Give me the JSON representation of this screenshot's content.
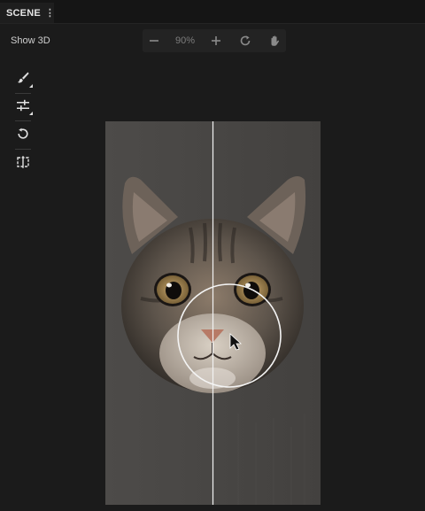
{
  "scene_tab": {
    "label": "SCENE",
    "menu_glyph": "⋮"
  },
  "view": {
    "toggle_label": "Show 3D"
  },
  "zoom": {
    "value": "90%",
    "minus_icon": "minus-icon",
    "plus_icon": "plus-icon",
    "reset_icon": "rotate-reset-icon",
    "pan_icon": "hand-pan-icon"
  },
  "tools": [
    {
      "name": "brush-tool",
      "icon": "brush-icon"
    },
    {
      "name": "adjust-tool",
      "icon": "sliders-icon"
    },
    {
      "name": "rotate-tool",
      "icon": "rotate-icon"
    },
    {
      "name": "compare-tool",
      "icon": "split-compare-icon"
    }
  ],
  "canvas": {
    "content": "cat face image",
    "split_view": true,
    "brush_cursor": true
  },
  "colors": {
    "background": "#1b1b1b",
    "canvas_bg": "#4a4846",
    "toolbar": "#232323"
  }
}
